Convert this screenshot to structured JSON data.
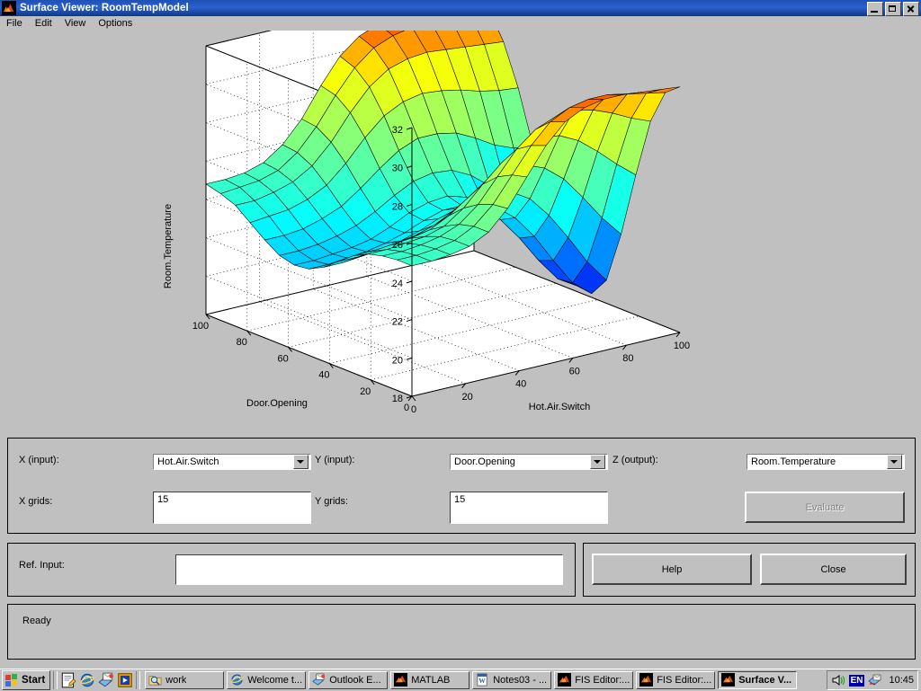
{
  "window": {
    "title": "Surface Viewer: RoomTempModel",
    "icon": "matlab-icon",
    "minimize_label": "Minimize",
    "maximize_label": "Restore",
    "close_label": "Close"
  },
  "menu": {
    "items": [
      {
        "label": "File"
      },
      {
        "label": "Edit"
      },
      {
        "label": "View"
      },
      {
        "label": "Options"
      }
    ]
  },
  "controls": {
    "x_input_label": "X (input):",
    "x_input_value": "Hot.Air.Switch",
    "y_input_label": "Y (input):",
    "y_input_value": "Door.Opening",
    "z_output_label": "Z (output):",
    "z_output_value": "Room.Temperature",
    "x_grids_label": "X grids:",
    "x_grids_value": "15",
    "y_grids_label": "Y grids:",
    "y_grids_value": "15",
    "evaluate_label": "Evaluate",
    "ref_input_label": "Ref. Input:",
    "ref_input_value": "",
    "help_label": "Help",
    "close_label": "Close",
    "status": "Ready"
  },
  "chart_data": {
    "type": "surface",
    "title": "",
    "xlabel": "Hot.Air.Switch",
    "ylabel": "Door.Opening",
    "zlabel": "Room.Temperature",
    "xlim": [
      0,
      100
    ],
    "ylim": [
      0,
      100
    ],
    "zlim": [
      18,
      32
    ],
    "xticks": [
      0,
      20,
      40,
      60,
      80,
      100
    ],
    "yticks": [
      0,
      20,
      40,
      60,
      80,
      100
    ],
    "zticks": [
      18,
      20,
      22,
      24,
      26,
      28,
      30,
      32
    ],
    "grid": true,
    "colormap": "jet",
    "colormap_stops": [
      "#0000bf",
      "#0040ff",
      "#0080ff",
      "#00bfff",
      "#00ffff",
      "#40ffbf",
      "#80ff80",
      "#bfff40",
      "#ffff00",
      "#ff8000",
      "#ff0000"
    ],
    "grid_size": 15,
    "x": [
      0,
      7.14,
      14.29,
      21.43,
      28.57,
      35.71,
      42.86,
      50,
      57.14,
      64.29,
      71.43,
      78.57,
      85.71,
      92.86,
      100
    ],
    "y": [
      0,
      7.14,
      14.29,
      21.43,
      28.57,
      35.71,
      42.86,
      50,
      57.14,
      64.29,
      71.43,
      78.57,
      85.71,
      92.86,
      100
    ],
    "z": [
      [
        24.8,
        24.8,
        24.9,
        25.1,
        25.6,
        26.6,
        28.0,
        29.4,
        30.4,
        30.9,
        31.1,
        31.1,
        31.0,
        30.9,
        30.8
      ],
      [
        24.8,
        24.8,
        24.9,
        25.1,
        25.6,
        26.5,
        27.8,
        29.1,
        30.1,
        30.6,
        30.8,
        30.8,
        30.6,
        30.4,
        30.2
      ],
      [
        24.7,
        24.7,
        24.8,
        25.0,
        25.4,
        26.2,
        27.4,
        28.6,
        29.4,
        29.8,
        29.9,
        29.7,
        29.3,
        28.8,
        28.4
      ],
      [
        24.5,
        24.5,
        24.6,
        24.7,
        25.0,
        25.7,
        26.7,
        27.6,
        28.2,
        28.4,
        28.3,
        27.8,
        27.0,
        26.1,
        25.3
      ],
      [
        24.1,
        24.1,
        24.2,
        24.3,
        24.5,
        25.0,
        25.7,
        26.4,
        26.7,
        26.7,
        26.3,
        25.5,
        24.3,
        23.0,
        21.9
      ],
      [
        23.5,
        23.5,
        23.6,
        23.7,
        23.9,
        24.2,
        24.7,
        25.1,
        25.2,
        25.0,
        24.4,
        23.3,
        21.9,
        20.4,
        19.2
      ],
      [
        22.9,
        22.9,
        23.0,
        23.1,
        23.3,
        23.6,
        24.0,
        24.3,
        24.3,
        23.9,
        23.1,
        21.9,
        20.4,
        19.0,
        18.2
      ],
      [
        22.5,
        22.5,
        22.6,
        22.7,
        22.9,
        23.2,
        23.6,
        23.9,
        23.9,
        23.5,
        22.7,
        21.5,
        20.1,
        18.9,
        18.3
      ],
      [
        22.4,
        22.4,
        22.5,
        22.6,
        22.8,
        23.2,
        23.7,
        24.0,
        24.1,
        23.8,
        23.1,
        22.1,
        20.9,
        19.9,
        19.5
      ],
      [
        22.6,
        22.6,
        22.7,
        22.9,
        23.2,
        23.7,
        24.3,
        24.8,
        25.0,
        24.9,
        24.4,
        23.6,
        22.7,
        22.0,
        21.8
      ],
      [
        23.1,
        23.1,
        23.2,
        23.5,
        23.9,
        24.6,
        25.4,
        26.1,
        26.5,
        26.5,
        26.3,
        25.8,
        25.2,
        24.8,
        24.7
      ],
      [
        23.7,
        23.8,
        23.9,
        24.2,
        24.7,
        25.6,
        26.7,
        27.6,
        28.1,
        28.3,
        28.2,
        28.0,
        27.7,
        27.5,
        27.4
      ],
      [
        24.3,
        24.3,
        24.5,
        24.8,
        25.4,
        26.4,
        27.7,
        28.8,
        29.5,
        29.8,
        29.9,
        29.8,
        29.7,
        29.6,
        29.5
      ],
      [
        24.6,
        24.7,
        24.8,
        25.1,
        25.8,
        26.9,
        28.3,
        29.5,
        30.3,
        30.7,
        30.9,
        30.9,
        30.9,
        30.9,
        30.9
      ],
      [
        24.8,
        24.8,
        24.9,
        25.2,
        25.9,
        27.0,
        28.5,
        29.8,
        30.6,
        31.0,
        31.2,
        31.3,
        31.3,
        31.3,
        31.3
      ]
    ]
  },
  "taskbar": {
    "start_label": "Start",
    "quick_launch": [
      {
        "name": "notepad-icon"
      },
      {
        "name": "internet-explorer-icon"
      },
      {
        "name": "outlook-express-icon"
      },
      {
        "name": "media-player-icon"
      }
    ],
    "tasks": [
      {
        "label": "work",
        "icon": "folder-search-icon",
        "active": false
      },
      {
        "label": "Welcome t...",
        "icon": "internet-explorer-icon",
        "active": false
      },
      {
        "label": "Outlook E...",
        "icon": "outlook-express-icon",
        "active": false
      },
      {
        "label": "MATLAB",
        "icon": "matlab-icon",
        "active": false
      },
      {
        "label": "Notes03 - ...",
        "icon": "word-icon",
        "active": false
      },
      {
        "label": "FIS Editor:...",
        "icon": "matlab-icon",
        "active": false
      },
      {
        "label": "FIS Editor:...",
        "icon": "matlab-icon",
        "active": false
      },
      {
        "label": "Surface V...",
        "icon": "matlab-icon",
        "active": true
      }
    ],
    "tray": {
      "volume_icon": "speaker-icon",
      "language": "EN",
      "network_icon": "network-mail-icon",
      "clock": "10:45"
    }
  }
}
